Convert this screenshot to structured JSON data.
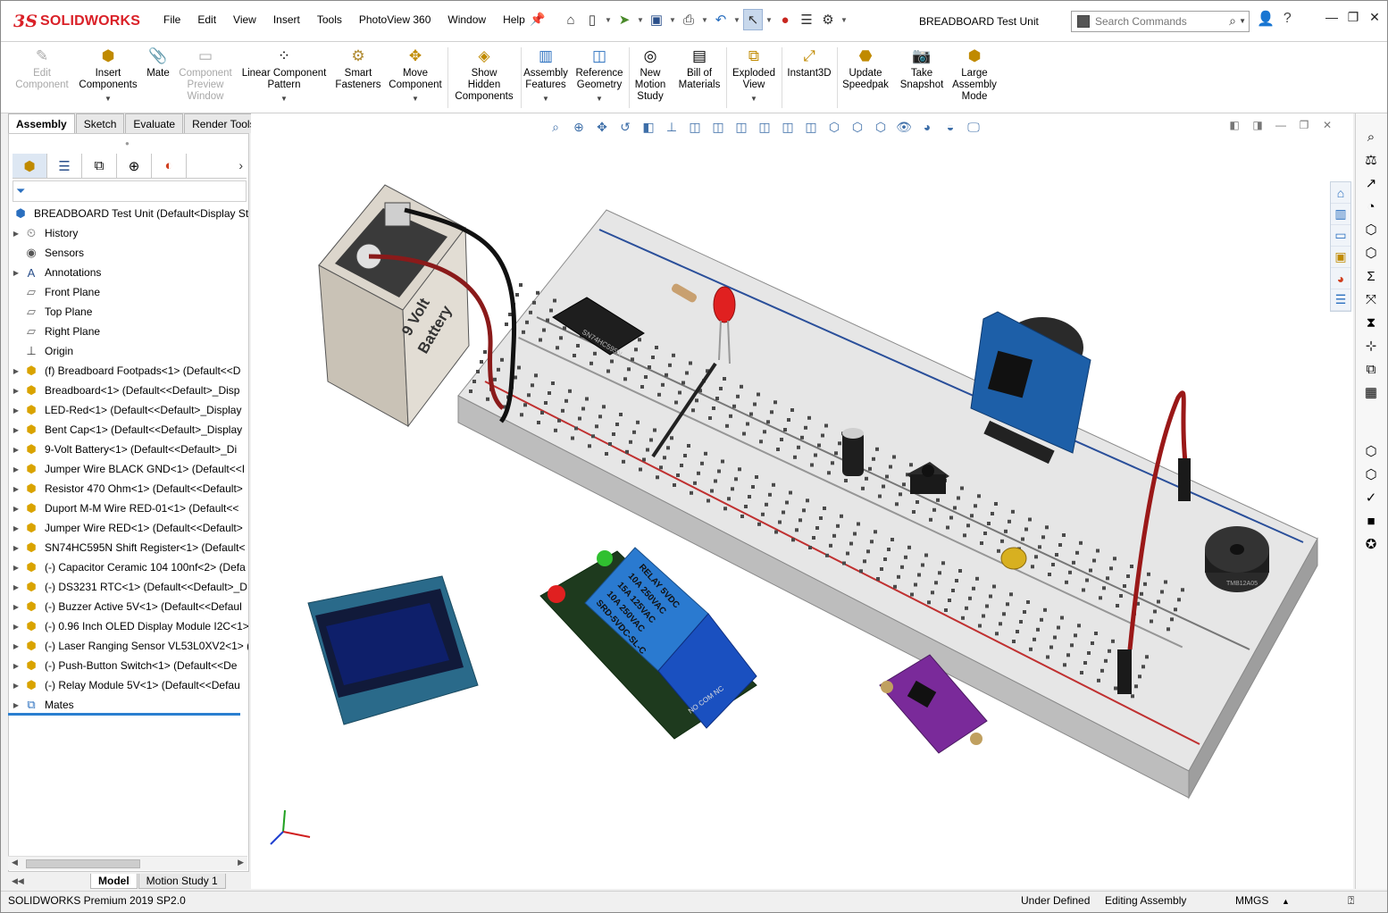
{
  "app": {
    "brand_ds": "3S",
    "brand_name": "SOLIDWORKS"
  },
  "menu": [
    "File",
    "Edit",
    "View",
    "Insert",
    "Tools",
    "PhotoView 360",
    "Window",
    "Help"
  ],
  "document_title": "BREADBOARD Test Unit",
  "search": {
    "placeholder": "Search Commands"
  },
  "commands": [
    {
      "label1": "Edit",
      "label2": "Component",
      "label3": "",
      "icon": "edit-component-icon",
      "enabled": false
    },
    {
      "label1": "Insert",
      "label2": "Components",
      "label3": "",
      "icon": "insert-components-icon",
      "enabled": true
    },
    {
      "label1": "Mate",
      "label2": "",
      "label3": "",
      "icon": "mate-icon",
      "enabled": true
    },
    {
      "label1": "Component",
      "label2": "Preview",
      "label3": "Window",
      "icon": "preview-window-icon",
      "enabled": false
    },
    {
      "label1": "Linear Component",
      "label2": "Pattern",
      "label3": "",
      "icon": "linear-pattern-icon",
      "enabled": true
    },
    {
      "label1": "Smart",
      "label2": "Fasteners",
      "label3": "",
      "icon": "smart-fasteners-icon",
      "enabled": true
    },
    {
      "label1": "Move",
      "label2": "Component",
      "label3": "",
      "icon": "move-component-icon",
      "enabled": true
    },
    {
      "label1": "Show",
      "label2": "Hidden",
      "label3": "Components",
      "icon": "show-hidden-icon",
      "enabled": true
    },
    {
      "label1": "Assembly",
      "label2": "Features",
      "label3": "",
      "icon": "assembly-features-icon",
      "enabled": true
    },
    {
      "label1": "Reference",
      "label2": "Geometry",
      "label3": "",
      "icon": "reference-geometry-icon",
      "enabled": true
    },
    {
      "label1": "New",
      "label2": "Motion",
      "label3": "Study",
      "icon": "motion-study-icon",
      "enabled": true
    },
    {
      "label1": "Bill of",
      "label2": "Materials",
      "label3": "",
      "icon": "bom-icon",
      "enabled": true
    },
    {
      "label1": "Exploded",
      "label2": "View",
      "label3": "",
      "icon": "exploded-view-icon",
      "enabled": true
    },
    {
      "label1": "Instant3D",
      "label2": "",
      "label3": "",
      "icon": "instant3d-icon",
      "enabled": true
    },
    {
      "label1": "Update",
      "label2": "Speedpak",
      "label3": "",
      "icon": "speedpak-icon",
      "enabled": true
    },
    {
      "label1": "Take",
      "label2": "Snapshot",
      "label3": "",
      "icon": "snapshot-icon",
      "enabled": true
    },
    {
      "label1": "Large",
      "label2": "Assembly",
      "label3": "Mode",
      "icon": "large-assembly-icon",
      "enabled": true
    }
  ],
  "tabs": [
    "Assembly",
    "Sketch",
    "Evaluate",
    "Render Tools"
  ],
  "active_tab": "Assembly",
  "tree": {
    "root": "BREADBOARD Test Unit  (Default<Display Stat",
    "items": [
      {
        "label": "History",
        "icon": "history-icon",
        "expandable": true
      },
      {
        "label": "Sensors",
        "icon": "sensors-icon",
        "expandable": false
      },
      {
        "label": "Annotations",
        "icon": "annotations-icon",
        "expandable": true
      },
      {
        "label": "Front Plane",
        "icon": "plane-icon",
        "expandable": false
      },
      {
        "label": "Top Plane",
        "icon": "plane-icon",
        "expandable": false
      },
      {
        "label": "Right Plane",
        "icon": "plane-icon",
        "expandable": false
      },
      {
        "label": "Origin",
        "icon": "origin-icon",
        "expandable": false
      },
      {
        "label": "(f) Breadboard Footpads<1> (Default<<D",
        "icon": "part-icon",
        "expandable": true
      },
      {
        "label": "Breadboard<1> (Default<<Default>_Disp",
        "icon": "part-icon",
        "expandable": true
      },
      {
        "label": "LED-Red<1> (Default<<Default>_Display",
        "icon": "part-icon",
        "expandable": true
      },
      {
        "label": "Bent Cap<1> (Default<<Default>_Display",
        "icon": "part-icon",
        "expandable": true
      },
      {
        "label": "9-Volt Battery<1> (Default<<Default>_Di",
        "icon": "part-icon",
        "expandable": true
      },
      {
        "label": "Jumper Wire BLACK GND<1> (Default<<I",
        "icon": "part-icon",
        "expandable": true
      },
      {
        "label": "Resistor 470 Ohm<1> (Default<<Default>",
        "icon": "part-icon",
        "expandable": true
      },
      {
        "label": "Duport M-M Wire RED-01<1> (Default<<",
        "icon": "part-icon",
        "expandable": true
      },
      {
        "label": "Jumper Wire RED<1> (Default<<Default>",
        "icon": "part-icon",
        "expandable": true
      },
      {
        "label": "SN74HC595N Shift Register<1> (Default<",
        "icon": "part-icon",
        "expandable": true
      },
      {
        "label": "(-) Capacitor Ceramic 104 100nf<2> (Defa",
        "icon": "part-icon",
        "expandable": true
      },
      {
        "label": "(-) DS3231 RTC<1> (Default<<Default>_D",
        "icon": "part-icon",
        "expandable": true
      },
      {
        "label": "(-) Buzzer Active 5V<1> (Default<<Defaul",
        "icon": "part-icon",
        "expandable": true
      },
      {
        "label": "(-) 0.96 Inch OLED Display Module I2C<1>",
        "icon": "part-icon",
        "expandable": true
      },
      {
        "label": "(-) Laser Ranging Sensor VL53L0XV2<1> (",
        "icon": "part-icon",
        "expandable": true
      },
      {
        "label": "(-) Push-Button Switch<1> (Default<<De",
        "icon": "part-icon",
        "expandable": true
      },
      {
        "label": "(-) Relay Module 5V<1> (Default<<Defau",
        "icon": "part-icon",
        "expandable": true
      },
      {
        "label": "Mates",
        "icon": "mates-icon",
        "expandable": true
      }
    ]
  },
  "bottom_tabs": [
    "Model",
    "Motion Study 1"
  ],
  "status": {
    "product": "SOLIDWORKS Premium 2019 SP2.0",
    "definition": "Under Defined",
    "mode": "Editing Assembly",
    "units": "MMGS",
    "units_arrow": "▲"
  },
  "model_labels": {
    "battery_line1": "9 Volt",
    "battery_line2": "Battery",
    "relay_line1": "RELAY  5VDC",
    "relay_line2": "10A 250VAC",
    "relay_line3": "15A 125VAC",
    "relay_line4": "10A 250VAC",
    "relay_line5": "SRD-5VDC-SL-C",
    "relay_terminals": "NO  COM  NC",
    "buzzer_label": "TMB12A05",
    "chip_label": "SN74HC595N"
  },
  "colors": {
    "accent": "#2a7fd0",
    "brand": "#da2128",
    "part_icon": "#d9a300"
  }
}
